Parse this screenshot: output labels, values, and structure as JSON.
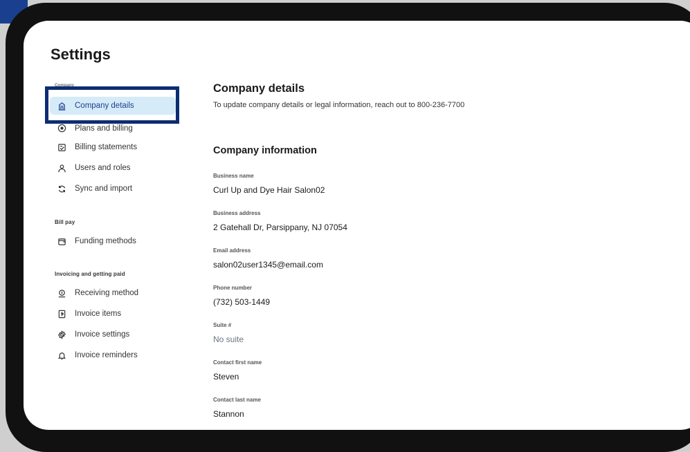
{
  "page": {
    "title": "Settings"
  },
  "sidebar": {
    "groups": [
      {
        "label": "Company",
        "items": [
          {
            "label": "Company details",
            "icon": "building-icon",
            "active": true
          },
          {
            "label": "Plans and billing",
            "icon": "radio-dot-icon"
          },
          {
            "label": "Billing statements",
            "icon": "statement-icon"
          },
          {
            "label": "Users and roles",
            "icon": "user-icon"
          },
          {
            "label": "Sync and import",
            "icon": "sync-icon"
          }
        ]
      },
      {
        "label": "Bill pay",
        "items": [
          {
            "label": "Funding methods",
            "icon": "wallet-icon"
          }
        ]
      },
      {
        "label": "Invoicing and getting paid",
        "items": [
          {
            "label": "Receiving method",
            "icon": "coin-hand-icon"
          },
          {
            "label": "Invoice items",
            "icon": "invoice-icon"
          },
          {
            "label": "Invoice settings",
            "icon": "gear-icon"
          },
          {
            "label": "Invoice reminders",
            "icon": "bell-icon"
          }
        ]
      }
    ]
  },
  "main": {
    "title": "Company details",
    "subtitle": "To update company details or legal information, reach out to 800-236-7700",
    "section_title": "Company information",
    "fields": [
      {
        "label": "Business name",
        "value": "Curl Up and Dye Hair Salon02"
      },
      {
        "label": "Business address",
        "value": "2 Gatehall Dr, Parsippany, NJ 07054"
      },
      {
        "label": "Email address",
        "value": "salon02user1345@email.com"
      },
      {
        "label": "Phone number",
        "value": "(732) 503-1449"
      },
      {
        "label": "Suite #",
        "value": "No suite"
      },
      {
        "label": "Contact first name",
        "value": "Steven"
      },
      {
        "label": "Contact last name",
        "value": "Stannon"
      }
    ]
  },
  "colors": {
    "accent": "#1b3f8f",
    "active_bg": "#d6ebf8",
    "highlight_border": "#0d2d73"
  }
}
